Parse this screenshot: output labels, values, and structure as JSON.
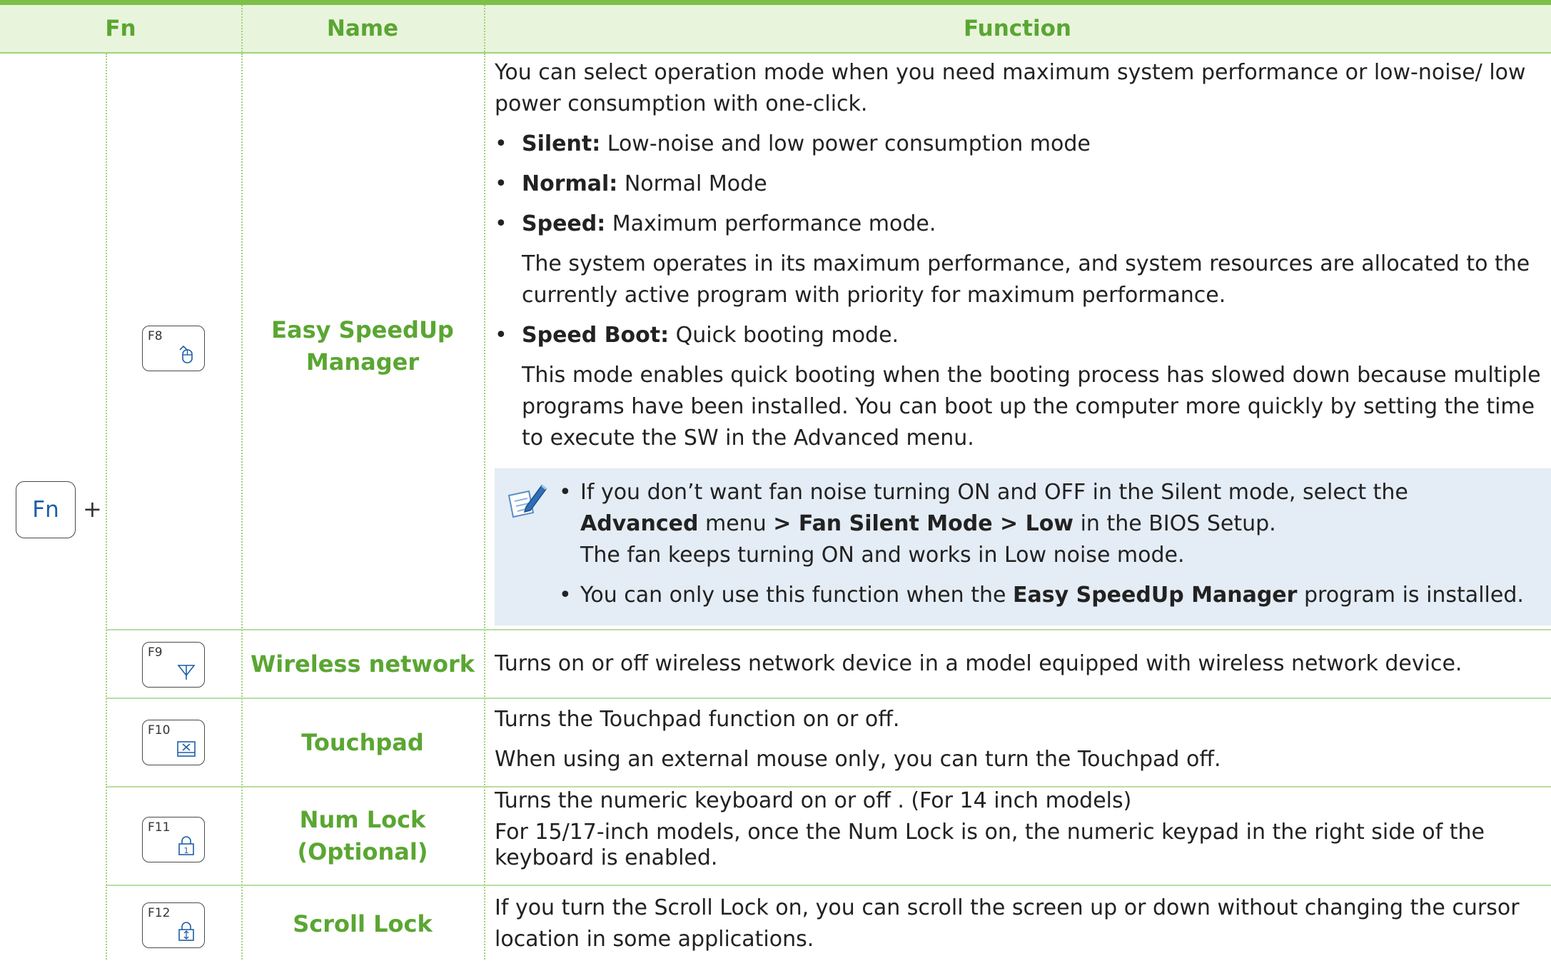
{
  "header": {
    "col_fn": "Fn",
    "col_name": "Name",
    "col_function": "Function"
  },
  "fn_key": {
    "label": "Fn",
    "plus": "+"
  },
  "rows": [
    {
      "key": "F8",
      "icon": "mouse-speedup-icon",
      "name": "Easy SpeedUp\nManager",
      "intro": "You can select operation mode when you need maximum system performance or low-noise/ low power consumption with one-click.",
      "modes": [
        {
          "label": "Silent:",
          "text": " Low-noise and low power consumption mode"
        },
        {
          "label": "Normal:",
          "text": "  Normal Mode"
        },
        {
          "label": "Speed:",
          "text": "  Maximum performance mode."
        },
        {
          "label": "Speed Boot:",
          "text": "  Quick booting mode."
        }
      ],
      "speed_desc": "The system operates in its maximum performance, and system resources are allocated to the currently active program with priority for maximum performance.",
      "boot_desc": "This mode enables quick booting when the booting process has slowed down because multiple programs have been installed. You can boot up the computer more quickly by setting the time to execute the SW in the Advanced menu.",
      "note": {
        "icon": "note-pencil-icon",
        "n1_pre": "If you don’t want fan noise turning ON and OFF in the Silent mode, select the",
        "n1_b1": "Advanced",
        "n1_m1": " menu ",
        "n1_b2": "> Fan Silent Mode > Low",
        "n1_post": " in the BIOS Setup.",
        "n1_line3": "The fan keeps turning ON and works in Low noise mode.",
        "n2_pre": "You can only use this function when the ",
        "n2_b": "Easy SpeedUp Manager",
        "n2_post": " program is installed."
      }
    },
    {
      "key": "F9",
      "icon": "wireless-antenna-icon",
      "name": "Wireless network",
      "text": "Turns on or off wireless network device in a model equipped with wireless network device."
    },
    {
      "key": "F10",
      "icon": "touchpad-off-icon",
      "name": "Touchpad",
      "line1": "Turns the Touchpad function on or off.",
      "line2": "When using an external mouse only, you can turn the Touchpad off."
    },
    {
      "key": "F11",
      "icon": "num-lock-icon",
      "name": "Num Lock\n(Optional)",
      "line1": "Turns the numeric keyboard on or off . (For 14 inch models)",
      "line2": "For 15/17-inch models, once the Num Lock is on, the numeric keypad in the right side of the keyboard is enabled."
    },
    {
      "key": "F12",
      "icon": "scroll-lock-icon",
      "name": "Scroll Lock",
      "text": "If you turn the Scroll Lock on, you can scroll the screen up or down without changing the cursor location in some applications."
    }
  ],
  "colors": {
    "accent_green": "#5aa632",
    "header_bg": "#e9f4dc",
    "note_bg": "#e4ecf5",
    "fn_blue": "#1d5fa6"
  }
}
